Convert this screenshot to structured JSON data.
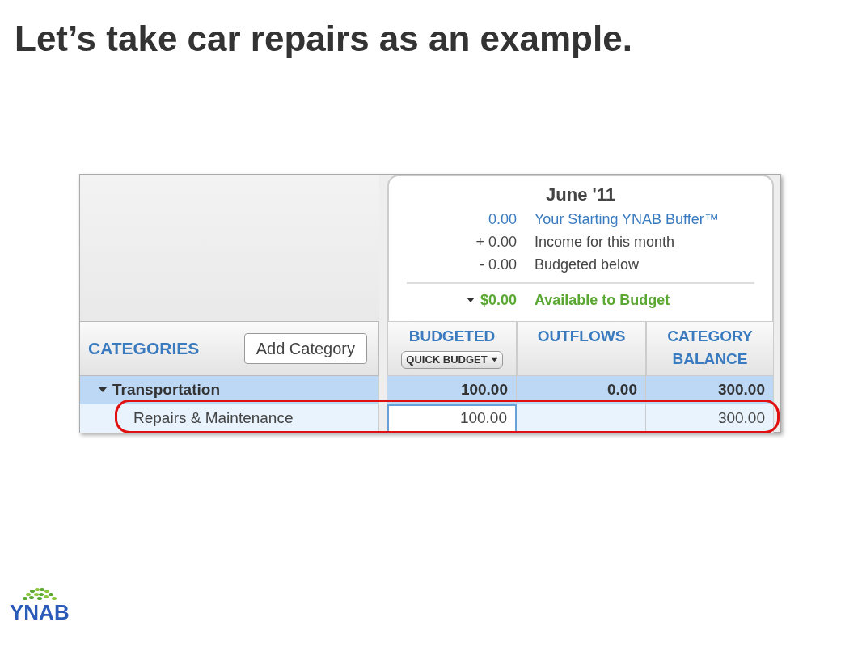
{
  "slide_title": "Let’s take car repairs as an example.",
  "summary": {
    "month": "June '11",
    "lines": [
      {
        "kind": "buffer",
        "amount": "0.00",
        "label": "Your Starting YNAB Buffer™"
      },
      {
        "kind": "income",
        "amount": "+ 0.00",
        "label": "Income for this month"
      },
      {
        "kind": "budgeted",
        "amount": "- 0.00",
        "label": "Budgeted below"
      }
    ],
    "available": {
      "amount": "$0.00",
      "label": "Available to Budget",
      "expanded": true
    }
  },
  "categories_header": {
    "title": "CATEGORIES",
    "add_button": "Add Category"
  },
  "columns": [
    "BUDGETED",
    "OUTFLOWS",
    "CATEGORY BALANCE"
  ],
  "quick_budget_button": "QUICK BUDGET",
  "groups": [
    {
      "name": "Transportation",
      "expanded": true,
      "budgeted": "100.00",
      "outflows": "0.00",
      "balance": "300.00",
      "children": [
        {
          "name": "Repairs & Maintenance",
          "budgeted": "100.00",
          "balance": "300.00",
          "editing": true,
          "highlighted": true
        }
      ]
    }
  ],
  "logo": "YNAB"
}
